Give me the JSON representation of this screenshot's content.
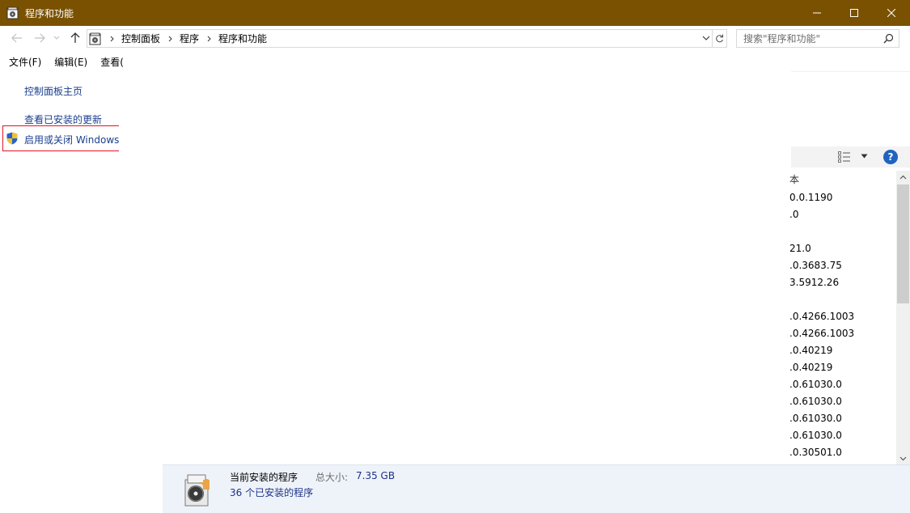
{
  "window": {
    "title": "程序和功能",
    "controls": [
      "minimize",
      "maximize",
      "close"
    ]
  },
  "address": {
    "breadcrumbs": [
      "控制面板",
      "程序",
      "程序和功能"
    ],
    "search_placeholder": "搜索\"程序和功能\""
  },
  "menu": [
    "文件(F)",
    "编辑(E)",
    "查看("
  ],
  "left_pane": {
    "home_link": "控制面板主页",
    "updates_link": "查看已安装的更新",
    "features_link": "启用或关闭 Windows"
  },
  "list": {
    "version_header": "本",
    "versions": [
      "0.0.1190",
      ".0",
      "",
      "21.0",
      ".0.3683.75",
      "3.5912.26",
      "",
      ".0.4266.1003",
      ".0.4266.1003",
      ".0.40219",
      ".0.40219",
      ".0.61030.0",
      ".0.61030.0",
      ".0.61030.0",
      ".0.61030.0",
      ".0.30501.0"
    ]
  },
  "details": {
    "title": "当前安装的程序",
    "size_label": "总大小:",
    "size_value": "7.35 GB",
    "count": "36 个已安装的程序"
  },
  "colors": {
    "titlebar": "#7a5100",
    "link": "#1a3e8c",
    "highlight_border": "#e81123",
    "details_bg": "#eef3fa"
  }
}
